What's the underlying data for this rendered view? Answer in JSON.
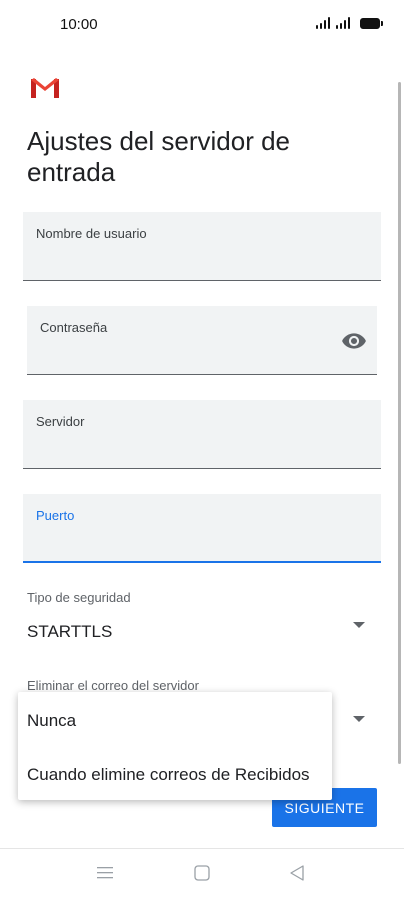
{
  "status_bar": {
    "time": "10:00"
  },
  "page": {
    "title": "Ajustes del servidor de entrada"
  },
  "fields": {
    "username": {
      "label": "Nombre de usuario",
      "value": ""
    },
    "password": {
      "label": "Contraseña",
      "value": ""
    },
    "server": {
      "label": "Servidor",
      "value": ""
    },
    "port": {
      "label": "Puerto",
      "value": ""
    }
  },
  "security": {
    "label": "Tipo de seguridad",
    "value": "STARTTLS"
  },
  "delete_from_server": {
    "label": "Eliminar el correo del servidor",
    "options": [
      "Nunca",
      "Cuando elimine correos de Recibidos"
    ]
  },
  "actions": {
    "next_label": "SIGUIENTE"
  },
  "colors": {
    "accent": "#1a73e8",
    "field_bg": "#f1f3f4",
    "gmail_red": "#d93025"
  },
  "icons": [
    "gmail-logo",
    "eye-icon",
    "dropdown-arrow-icon",
    "menu-icon",
    "home-icon",
    "back-icon"
  ]
}
